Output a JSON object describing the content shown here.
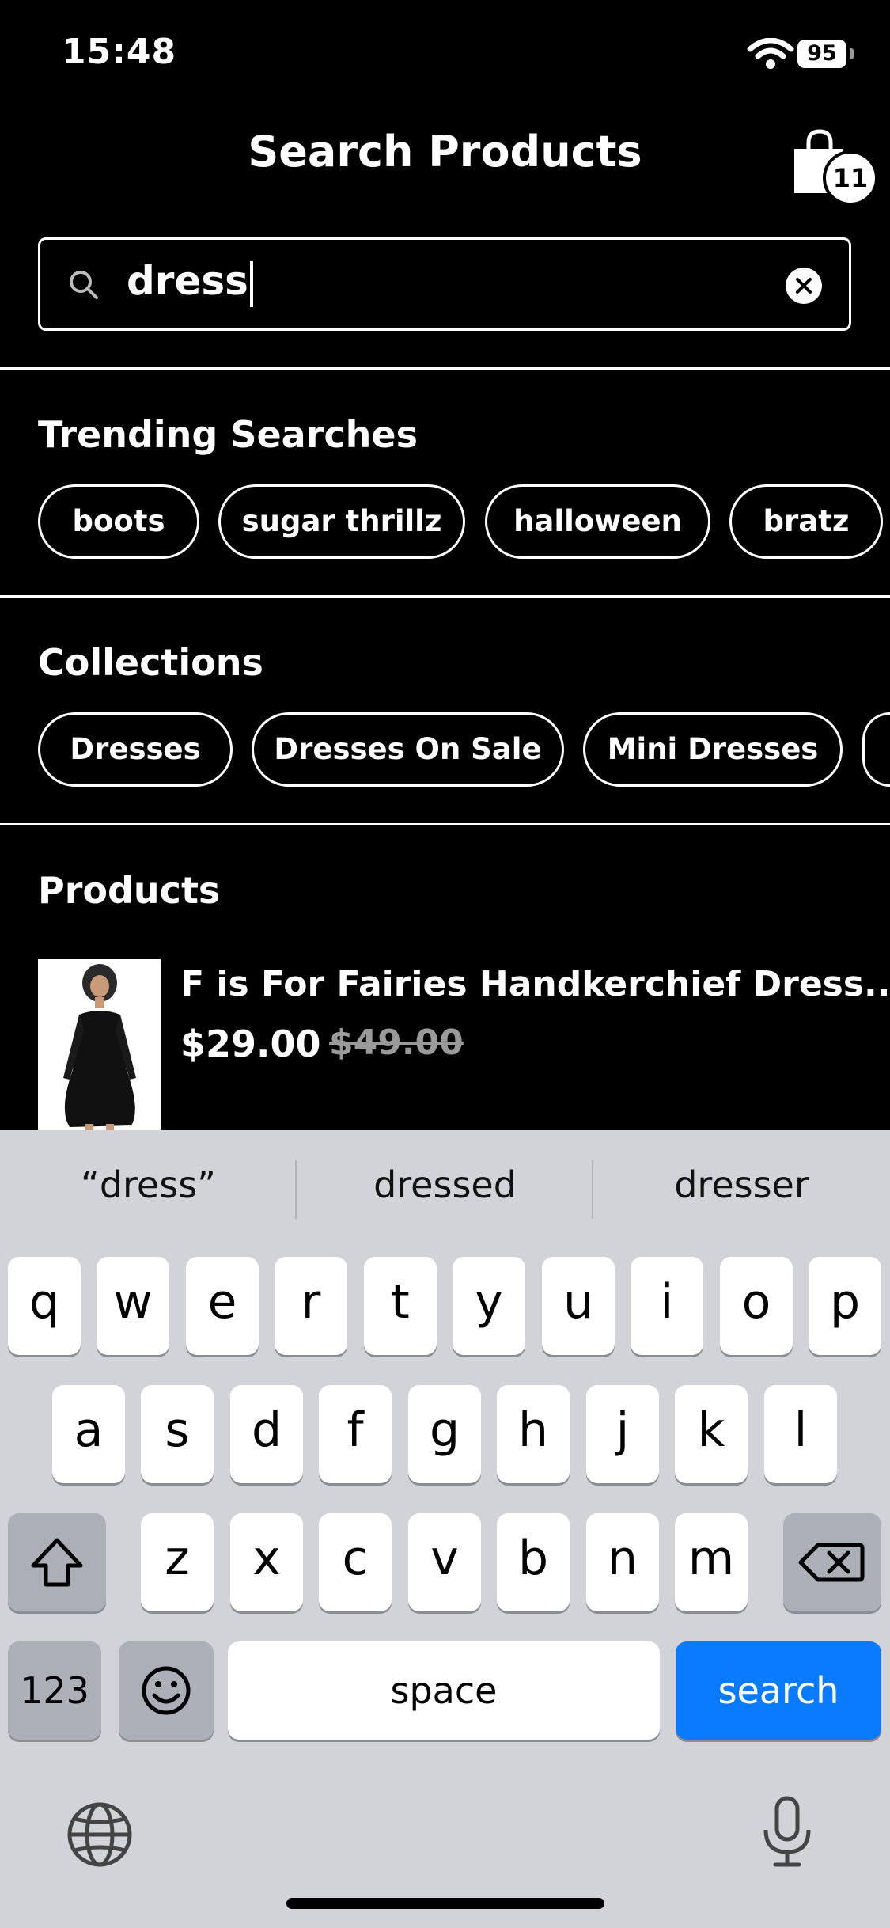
{
  "status_bar": {
    "time": "15:48",
    "battery": "95"
  },
  "header": {
    "title": "Search Products",
    "cart_count": "11"
  },
  "search": {
    "value": "dress"
  },
  "trending": {
    "title": "Trending Searches",
    "chips": [
      "boots",
      "sugar thrillz",
      "halloween",
      "bratz"
    ]
  },
  "collections": {
    "title": "Collections",
    "chips": [
      "Dresses",
      "Dresses On Sale",
      "Mini Dresses"
    ]
  },
  "products": {
    "title": "Products",
    "items": [
      {
        "name": "F is For Fairies Handkerchief Dress...",
        "price": "$29.00",
        "old_price": "$49.00"
      }
    ]
  },
  "keyboard": {
    "suggestions": [
      "“dress”",
      "dressed",
      "dresser"
    ],
    "row1": [
      "q",
      "w",
      "e",
      "r",
      "t",
      "y",
      "u",
      "i",
      "o",
      "p"
    ],
    "row2": [
      "a",
      "s",
      "d",
      "f",
      "g",
      "h",
      "j",
      "k",
      "l"
    ],
    "row3": [
      "z",
      "x",
      "c",
      "v",
      "b",
      "n",
      "m"
    ],
    "numbers_label": "123",
    "space_label": "space",
    "search_label": "search"
  },
  "colors": {
    "background": "#000000",
    "keyboard": "#d1d3d9",
    "accent": "#0a7bff"
  }
}
